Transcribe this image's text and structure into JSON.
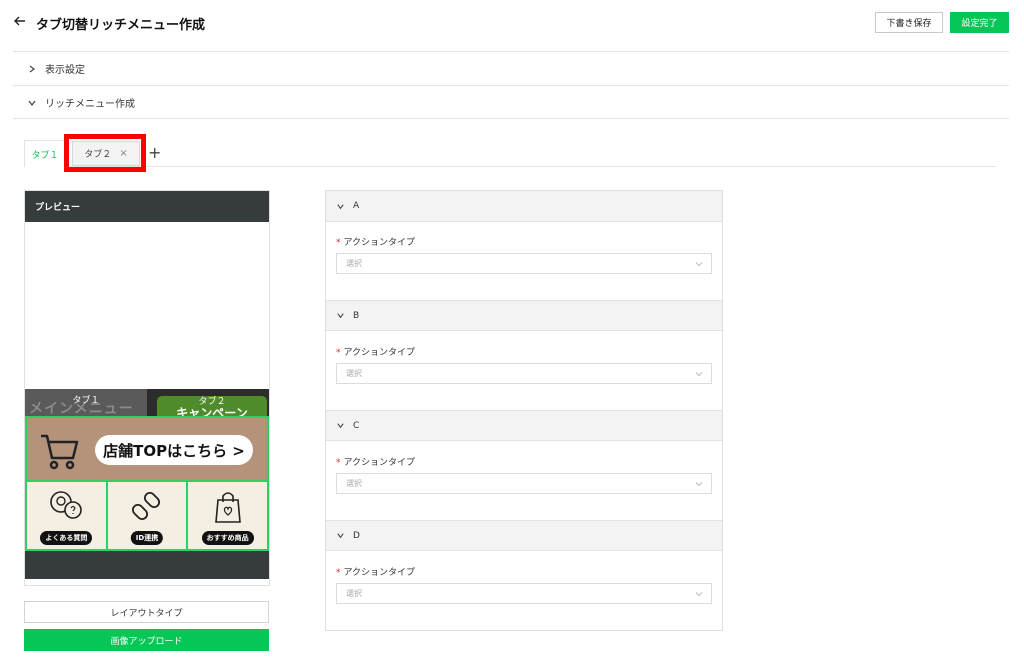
{
  "header": {
    "title": "タブ切替リッチメニュー作成",
    "draft_label": "下書き保存",
    "done_label": "設定完了"
  },
  "sections": [
    {
      "label": "表示設定",
      "state": "collapsed"
    },
    {
      "label": "リッチメニュー作成",
      "state": "expanded"
    }
  ],
  "tabs": {
    "items": [
      {
        "label": "タブ１",
        "active": true
      },
      {
        "label": "タブ２",
        "close": "×",
        "active": false
      }
    ],
    "add_label": "+"
  },
  "preview": {
    "header": "プレビュー",
    "rich_menu": {
      "tab1_label": "タブ１",
      "tab1_ghost": "メインメニュー",
      "tab2_label": "タブ２",
      "tab2_ghost": "キャンペーン",
      "banner_text": "店舗TOPはこちら >",
      "cells": [
        {
          "label": "よくある質問",
          "icon": "chat-bubbles-icon"
        },
        {
          "label": "ID連携",
          "icon": "link-icon"
        },
        {
          "label": "おすすめ商品",
          "icon": "shopping-bag-icon"
        }
      ]
    }
  },
  "buttons": {
    "layout_label": "レイアウトタイプ",
    "upload_label": "画像アップロード"
  },
  "action_areas": [
    {
      "name": "A",
      "field_label": "アクションタイプ",
      "required_mark": "*",
      "placeholder": "選択"
    },
    {
      "name": "B",
      "field_label": "アクションタイプ",
      "required_mark": "*",
      "placeholder": "選択"
    },
    {
      "name": "C",
      "field_label": "アクションタイプ",
      "required_mark": "*",
      "placeholder": "選択"
    },
    {
      "name": "D",
      "field_label": "アクションタイプ",
      "required_mark": "*",
      "placeholder": "選択"
    }
  ],
  "colors": {
    "accent": "#06c755",
    "highlight": "#ff0000",
    "dark": "#363b3e"
  }
}
